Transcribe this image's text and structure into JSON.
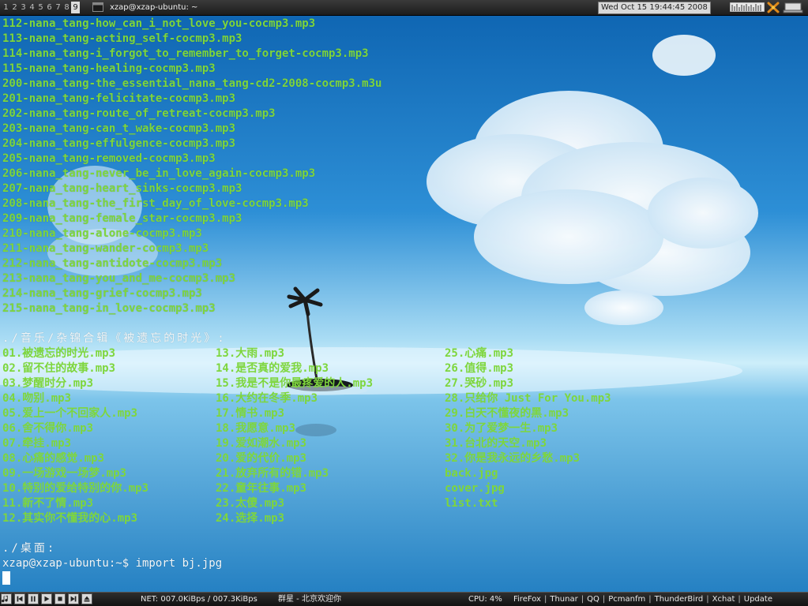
{
  "topbar": {
    "workspaces": [
      "1",
      "2",
      "3",
      "4",
      "5",
      "6",
      "7",
      "8",
      "9"
    ],
    "active_workspace_index": 8,
    "window_title": "xzap@xzap-ubuntu: ~",
    "clock": "Wed Oct 15 19:44:45 2008"
  },
  "terminal": {
    "colors": {
      "file": "#7ed63c",
      "text": "#f2f6f8"
    },
    "list_lines": [
      "112-nana_tang-how_can_i_not_love_you-cocmp3.mp3",
      "113-nana_tang-acting_self-cocmp3.mp3",
      "114-nana_tang-i_forgot_to_remember_to_forget-cocmp3.mp3",
      "115-nana_tang-healing-cocmp3.mp3",
      "200-nana_tang-the_essential_nana_tang-cd2-2008-cocmp3.m3u",
      "201-nana_tang-felicitate-cocmp3.mp3",
      "202-nana_tang-route_of_retreat-cocmp3.mp3",
      "203-nana_tang-can_t_wake-cocmp3.mp3",
      "204-nana_tang-effulgence-cocmp3.mp3",
      "205-nana_tang-removed-cocmp3.mp3",
      "206-nana_tang-never_be_in_love_again-cocmp3.mp3",
      "207-nana_tang-heart_sinks-cocmp3.mp3",
      "208-nana_tang-the_first_day_of_love-cocmp3.mp3",
      "209-nana_tang-female_star-cocmp3.mp3",
      "210-nana_tang-alone-cocmp3.mp3",
      "211-nana_tang-wander-cocmp3.mp3",
      "212-nana_tang-antidote-cocmp3.mp3",
      "213-nana_tang-you_and_me-cocmp3.mp3",
      "214-nana_tang-grief-cocmp3.mp3",
      "215-nana_tang-in_love-cocmp3.mp3"
    ],
    "dir_header": "./音乐/杂锦合辑《被遗忘的时光》:",
    "grid": {
      "col1": [
        "01.被遗忘的时光.mp3",
        "02.留不住的故事.mp3",
        "03.梦醒时分.mp3",
        "04.吻别.mp3",
        "05.爱上一个不回家人.mp3",
        "06.舍不得你.mp3",
        "07.牵挂.mp3",
        "08.心痛的感觉.mp3",
        "09.一场游戏一场梦.mp3",
        "10.特别的爱给特别的你.mp3",
        "11.新不了情.mp3",
        "12.其实你不懂我的心.mp3"
      ],
      "col2": [
        "13.大雨.mp3",
        "14.是否真的爱我.mp3",
        "15.我是不是你最疼爱的人.mp3",
        "16.大约在冬季.mp3",
        "17.情书.mp3",
        "18.我愿意.mp3",
        "19.爱如潮水.mp3",
        "20.爱的代价.mp3",
        "21.放弃所有的错.mp3",
        "22.童年往事.mp3",
        "23.太傻.mp3",
        "24.选择.mp3"
      ],
      "col3": [
        "25.心痛.mp3",
        "26.值得.mp3",
        "27.哭砂.mp3",
        "28.只给你 Just For You.mp3",
        "29.白天不懂夜的黑.mp3",
        "30.为了爱梦一生.mp3",
        "31.台北的天空.mp3",
        "32.你是我永远的乡愁.mp3",
        "back.jpg",
        "cover.jpg",
        "list.txt"
      ]
    },
    "desktop_header": "./桌面:",
    "prompt": "xzap@xzap-ubuntu:~$ import bj.jpg"
  },
  "bottombar": {
    "player_buttons": [
      "music-icon",
      "prev-icon",
      "pause-icon",
      "play-icon",
      "stop-icon",
      "next-icon",
      "eject-icon"
    ],
    "net": "NET: 007.0KiBps / 007.3KiBps",
    "now_playing": "群星 - 北京欢迎你",
    "cpu": "CPU: 4%",
    "apps": [
      "FireFox",
      "Thunar",
      "QQ",
      "Pcmanfm",
      "ThunderBird",
      "Xchat",
      "Update"
    ]
  }
}
